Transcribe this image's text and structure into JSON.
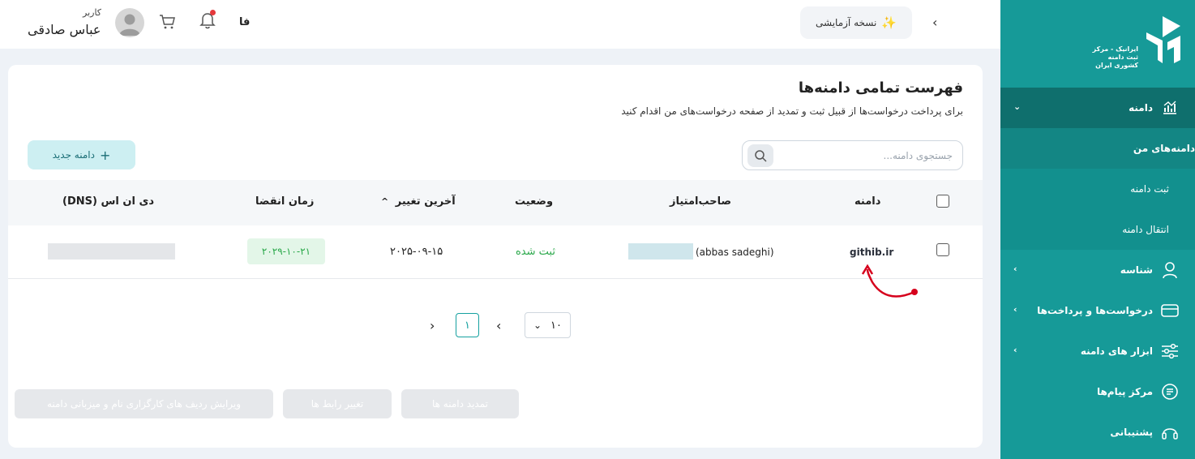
{
  "sidebar": {
    "logo_text": "ایرانیک - مرکز ثبت دامنه کشوری ایران",
    "items": [
      {
        "label": "دامنه",
        "icon": "chart-icon",
        "active": true
      },
      {
        "label": "دامنه‌های من"
      },
      {
        "label": "ثبت دامنه"
      },
      {
        "label": "انتقال دامنه"
      },
      {
        "label": "شناسه",
        "icon": "user-icon"
      },
      {
        "label": "درخواست‌ها و پرداخت‌ها",
        "icon": "card-icon"
      },
      {
        "label": "ابزار های دامنه",
        "icon": "sliders-icon"
      },
      {
        "label": "مرکز پیام‌ها",
        "icon": "message-icon"
      },
      {
        "label": "پشتیبانی",
        "icon": "headset-icon"
      }
    ]
  },
  "topbar": {
    "user_label": "کاربر",
    "user_name": "عباس صادقی",
    "lang": "فا",
    "demo_label": "نسخه آزمایشی"
  },
  "card": {
    "title": "فهرست تمامی دامنه‌ها",
    "subtitle": "برای پرداخت درخواست‌ها از قبیل ثبت و تمدید از صفحه درخواست‌های من اقدام کنید",
    "search_placeholder": "جستجوی دامنه...",
    "new_domain_label": "دامنه جدید"
  },
  "table": {
    "columns": [
      "دامنه",
      "صاحب‌امتیاز",
      "وضعیت",
      "آخرین تغییر",
      "زمان انقضا",
      "دی ان اس (DNS)"
    ],
    "sort_indicator": "^",
    "rows": [
      {
        "domain": "githib.ir",
        "owner": "(abbas sadeghi)",
        "status": "ثبت شده",
        "last_change": "۲۰۲۵-۰۹-۱۵",
        "expiry": "۲۰۲۹-۱۰-۲۱"
      }
    ]
  },
  "pagination": {
    "current_page": "۱",
    "per_page": "۱۰"
  },
  "actions": {
    "renew": "تمدید دامنه ها",
    "change_contact": "تغییر رابط ها",
    "edit_dns": "ویرایش ردیف های کارگزاری نام و میزبانی دامنه"
  },
  "colors": {
    "sidebar_bg": "#169a98",
    "sidebar_active": "#0f6f6d",
    "accent": "#16a1a0",
    "status_green": "#2aa84a",
    "annotation_red": "#d6001c"
  }
}
